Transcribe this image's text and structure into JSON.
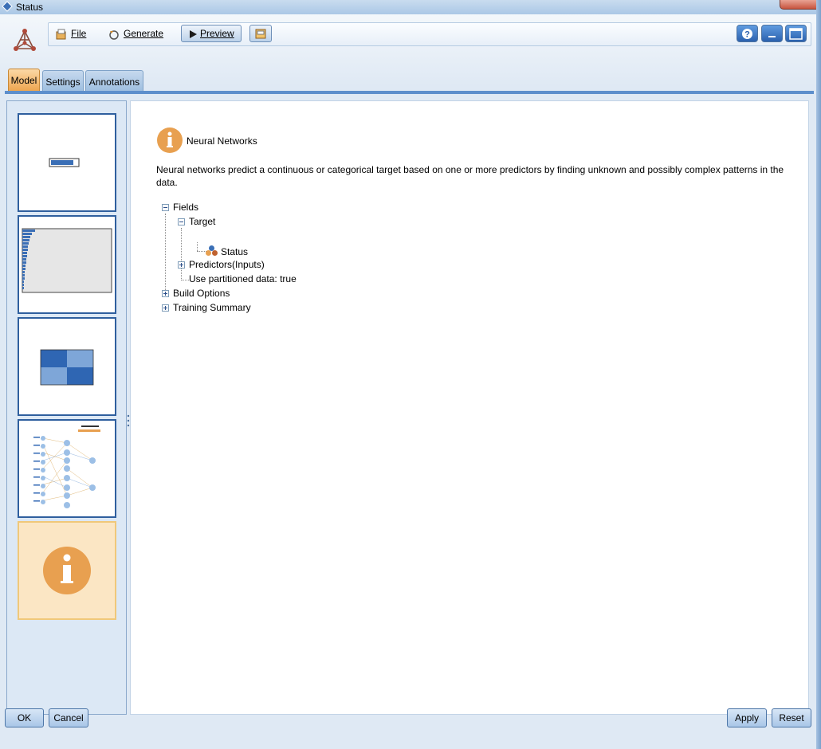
{
  "window": {
    "title": "Status"
  },
  "toolbar": {
    "file_label": "File",
    "generate_label": "Generate",
    "preview_label": "Preview"
  },
  "tabs": [
    {
      "label": "Model",
      "active": true
    },
    {
      "label": "Settings",
      "active": false
    },
    {
      "label": "Annotations",
      "active": false
    }
  ],
  "thumbnails": [
    {
      "name": "predictor-importance-thumb"
    },
    {
      "name": "bar-chart-thumb"
    },
    {
      "name": "classification-matrix-thumb"
    },
    {
      "name": "network-diagram-thumb"
    },
    {
      "name": "model-summary-thumb",
      "selected": true
    }
  ],
  "content": {
    "heading": "Neural Networks",
    "description": "Neural networks predict a continuous or categorical target based on one or more predictors by finding unknown and possibly complex patterns in the data.",
    "tree": {
      "fields": "Fields",
      "target": "Target",
      "status": "Status",
      "predictors": "Predictors(Inputs)",
      "partitioned": "Use partitioned data: true",
      "build_options": "Build Options",
      "training_summary": "Training Summary"
    }
  },
  "buttons": {
    "ok": "OK",
    "cancel": "Cancel",
    "apply": "Apply",
    "reset": "Reset"
  },
  "colors": {
    "accent_orange": "#e8a050",
    "accent_blue": "#2f66b3",
    "frame_blue": "#dbe7f3"
  }
}
